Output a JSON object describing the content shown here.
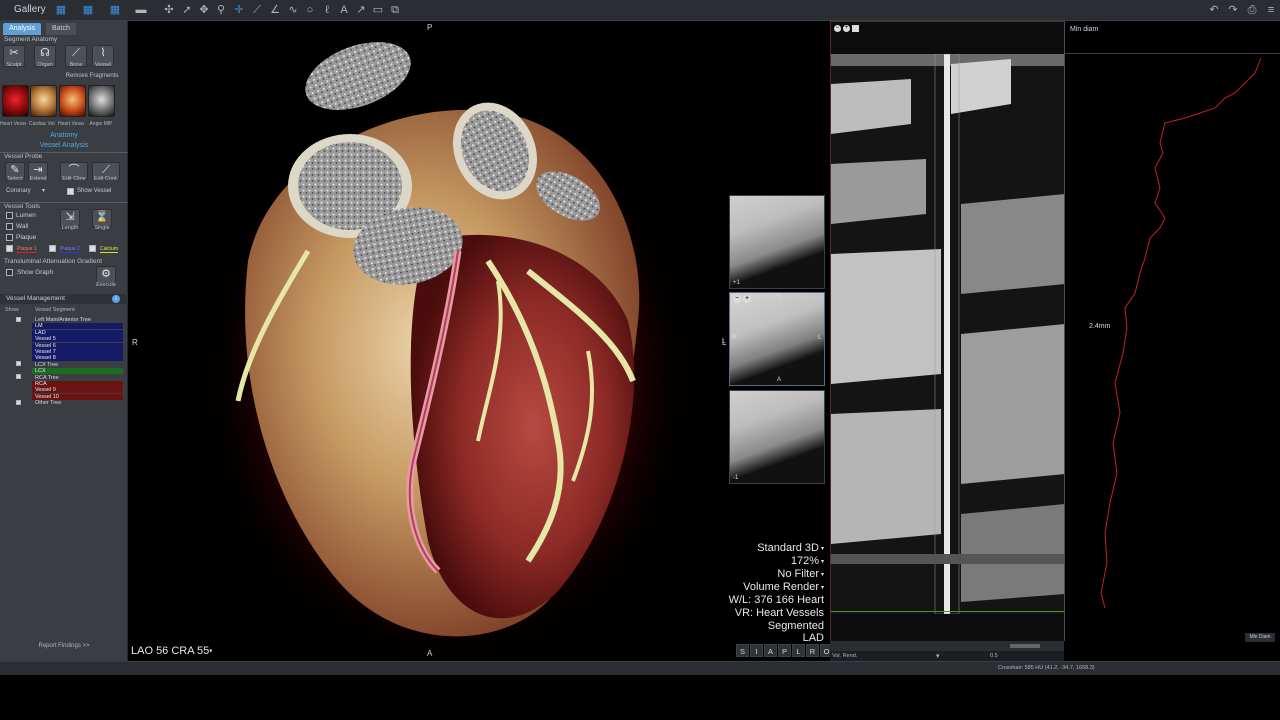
{
  "topbar": {
    "gallery_label": "Gallery"
  },
  "leftpanel": {
    "tabs": [
      "Analysis",
      "Batch"
    ],
    "segment_anatomy_title": "Segment Anatomy",
    "tools": [
      "Sculpt",
      "Organ",
      "Bone",
      "Vessel"
    ],
    "remove_fragments": "Remove Fragments",
    "presets": [
      "Heart Vessel...",
      "Cardiac Vol...",
      "Heart Vessels",
      "Angio MIP"
    ],
    "anatomy_link": "Anatomy",
    "vessel_analysis_link": "Vessel Analysis",
    "vessel_probe_title": "Vessel Probe",
    "probe_tools": [
      "Select",
      "Extend",
      "Edit Cline",
      "Edit Cont."
    ],
    "coronary_select": "Coronary",
    "show_vessel": "Show Vessel",
    "vessel_tools_title": "Vessel Tools",
    "vessel_tool_checks": [
      "Lumen",
      "Wall",
      "Plaque"
    ],
    "length_label": "Length",
    "single_label": "Single",
    "plaque_items": [
      "Plaque 1",
      "Plaque 2",
      "Calcium"
    ],
    "tag_title": "Transluminal Attenuation Gradient",
    "show_graph": "Show Graph",
    "execute_label": "Execute",
    "vessel_management_title": "Vessel Management",
    "vm_cols": [
      "Show",
      "Vessel Segment"
    ],
    "segments": [
      {
        "label": "Left Main/Anterior Tree",
        "style": "hdr",
        "checked": true
      },
      {
        "label": "LM",
        "style": "dark"
      },
      {
        "label": "LAD",
        "style": "dark"
      },
      {
        "label": "Vessel 5",
        "style": "dark"
      },
      {
        "label": "Vessel 6",
        "style": "dark"
      },
      {
        "label": "Vessel 7",
        "style": "dark"
      },
      {
        "label": "Vessel 8",
        "style": "dark"
      },
      {
        "label": "LCX Tree",
        "style": "hdr",
        "checked": true
      },
      {
        "label": "LCX",
        "style": "green"
      },
      {
        "label": "RCA Tree",
        "style": "hdr",
        "checked": true
      },
      {
        "label": "RCA",
        "style": "red"
      },
      {
        "label": "Vessel 9",
        "style": "red"
      },
      {
        "label": "Vessel 10",
        "style": "red"
      },
      {
        "label": "Other Tree",
        "style": "hdr",
        "checked": true
      }
    ],
    "report_findings": "Report Findings >>"
  },
  "viewport3d": {
    "top_label": "P",
    "bottom_label": "A",
    "left_label": "R",
    "right_label": "L",
    "orientation": "LAO 56  CRA 55",
    "info": [
      "Standard 3D",
      "172%",
      "No Filter",
      "Volume Render",
      "W/L: 376 166 Heart",
      "VR: Heart Vessels",
      "Segmented",
      "LAD"
    ],
    "info_arrows": [
      true,
      true,
      true,
      true,
      false,
      false,
      false,
      false
    ],
    "view_buttons": [
      "S",
      "I",
      "A",
      "P",
      "L",
      "R",
      "O"
    ]
  },
  "xsections": [
    {
      "label": "+1"
    },
    {
      "label": "A",
      "left": "R",
      "right": "L",
      "top": "S"
    },
    {
      "label": "-1"
    }
  ],
  "xsec_outer": {
    "left": "L"
  },
  "graph": {
    "title": "Min diam",
    "value": "2.4mm",
    "button": "Min Diam"
  },
  "cpr": {
    "strip_label": "Vol. Rend.",
    "strip_value": "0.5"
  },
  "status": {
    "crosshair": "Crosshair: 585 HU (41.2, -34.7, 1668.3)"
  },
  "colors": {
    "accent_blue": "#3b8ee0",
    "lad_segment": "#151a66",
    "lcx_segment": "#1c6b21",
    "rca_segment": "#6b1213"
  }
}
